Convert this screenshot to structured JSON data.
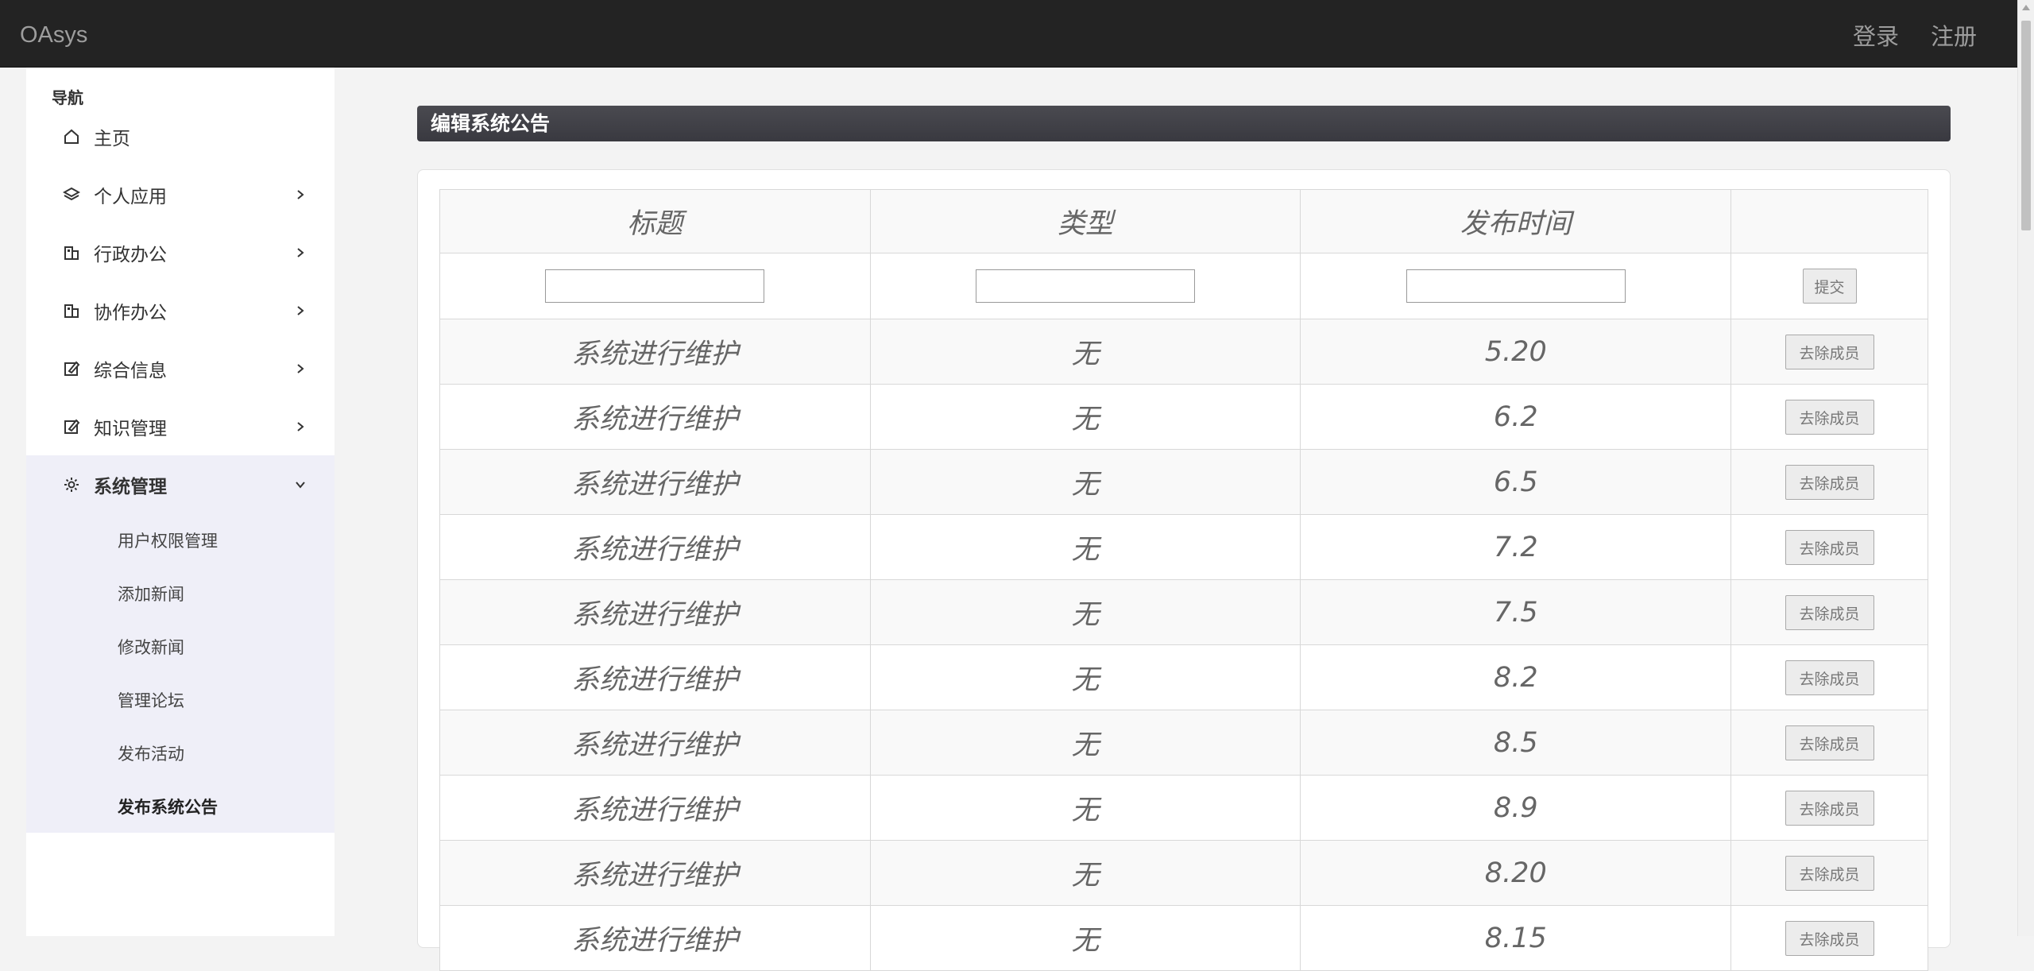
{
  "header": {
    "brand": "OAsys",
    "links": [
      "登录",
      "注册"
    ]
  },
  "sidebar": {
    "heading": "导航",
    "items": [
      {
        "label": "主页",
        "icon": "home-icon"
      },
      {
        "label": "个人应用",
        "icon": "layers-icon"
      },
      {
        "label": "行政办公",
        "icon": "building-icon"
      },
      {
        "label": "协作办公",
        "icon": "building-icon"
      },
      {
        "label": "综合信息",
        "icon": "edit-icon"
      },
      {
        "label": "知识管理",
        "icon": "edit-icon"
      },
      {
        "label": "系统管理",
        "icon": "gear-icon"
      }
    ],
    "sub_items": [
      "用户权限管理",
      "添加新闻",
      "修改新闻",
      "管理论坛",
      "发布活动",
      "发布系统公告"
    ]
  },
  "main": {
    "title": "编辑系统公告",
    "columns": [
      "标题",
      "类型",
      "发布时间",
      ""
    ],
    "submit_label": "提交",
    "remove_label": "去除成员",
    "rows": [
      {
        "title": "系统进行维护",
        "type": "无",
        "time": "5.20"
      },
      {
        "title": "系统进行维护",
        "type": "无",
        "time": "6.2"
      },
      {
        "title": "系统进行维护",
        "type": "无",
        "time": "6.5"
      },
      {
        "title": "系统进行维护",
        "type": "无",
        "time": "7.2"
      },
      {
        "title": "系统进行维护",
        "type": "无",
        "time": "7.5"
      },
      {
        "title": "系统进行维护",
        "type": "无",
        "time": "8.2"
      },
      {
        "title": "系统进行维护",
        "type": "无",
        "time": "8.5"
      },
      {
        "title": "系统进行维护",
        "type": "无",
        "time": "8.9"
      },
      {
        "title": "系统进行维护",
        "type": "无",
        "time": "8.20"
      },
      {
        "title": "系统进行维护",
        "type": "无",
        "time": "8.15"
      }
    ]
  }
}
